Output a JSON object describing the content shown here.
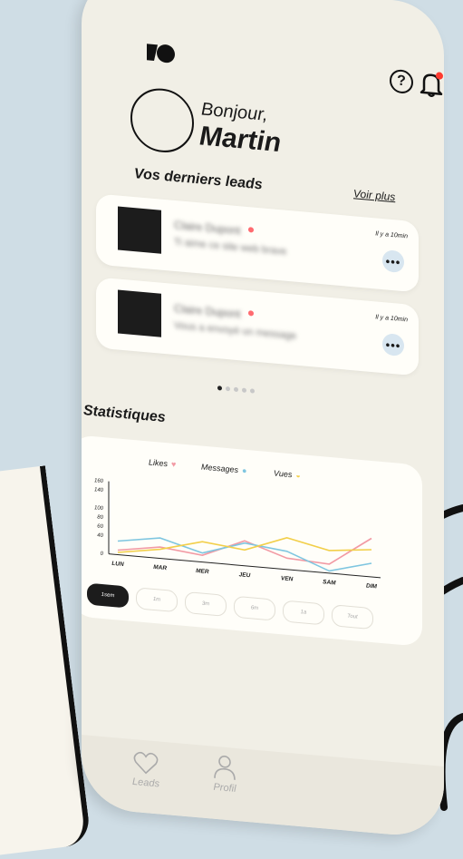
{
  "header": {
    "greeting": "Bonjour,",
    "user_name": "Martin"
  },
  "icons": {
    "logo": "brand-logo-icon",
    "help": "help-icon",
    "notifications": "bell-icon",
    "more": "more-dots-icon"
  },
  "help_glyph": "?",
  "leads": {
    "title": "Vos derniers leads",
    "see_more": "Voir plus",
    "items": [
      {
        "name": "Claire Dupont",
        "preview": "Ti aime ce site web brave",
        "time": "Il y a 10min",
        "menu": "•••"
      },
      {
        "name": "Claire Dupont",
        "preview": "Vous a envoyé un message",
        "time": "Il y a 10min",
        "menu": "•••"
      }
    ],
    "pager_count": 5,
    "pager_active": 0
  },
  "stats": {
    "title": "Statistiques",
    "legend": [
      {
        "label": "Likes",
        "symbol": "♥",
        "color": "#f29aa4"
      },
      {
        "label": "Messages",
        "symbol": "●",
        "color": "#7fc6e0"
      },
      {
        "label": "Vues",
        "symbol": "◒",
        "color": "#f2cf4a"
      }
    ],
    "filters": [
      "1sem",
      "1m",
      "3m",
      "6m",
      "1a",
      "Tout"
    ],
    "active_filter": "1sem"
  },
  "chart_data": {
    "type": "line",
    "categories": [
      "LUN",
      "MAR",
      "MER",
      "JEU",
      "VEN",
      "SAM",
      "DIM"
    ],
    "yticks": [
      0,
      40,
      60,
      80,
      100,
      140,
      160
    ],
    "ylim": [
      0,
      160
    ],
    "series": [
      {
        "name": "Likes",
        "color": "#f29aa4",
        "values": [
          10,
          25,
          15,
          55,
          25,
          20,
          85
        ]
      },
      {
        "name": "Messages",
        "color": "#7fc6e0",
        "values": [
          30,
          45,
          20,
          50,
          40,
          5,
          30
        ]
      },
      {
        "name": "Vues",
        "color": "#f2cf4a",
        "values": [
          5,
          20,
          45,
          35,
          70,
          50,
          60
        ]
      }
    ]
  },
  "nav": {
    "leads_label": "Leads",
    "profile_label": "Profil"
  }
}
